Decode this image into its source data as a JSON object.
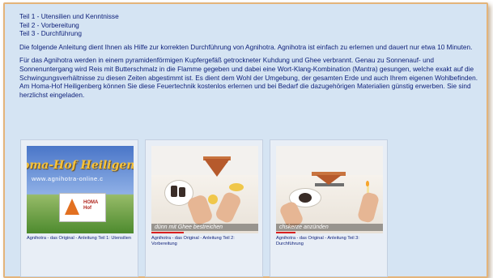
{
  "parts": [
    "Teil 1 - Utensilien und Kenntnisse",
    "Teil 2 - Vorbereitung",
    "Teil 3 - Durchführung"
  ],
  "intro": "Die folgende Anleitung dient Ihnen als Hilfe zur korrekten Durchführung von Agnihotra. Agnihotra ist einfach zu erlernen und dauert nur etwa 10 Minuten.",
  "body": "Für das Agnihotra werden in einem pyramidenförmigen Kupfergefäß getrockneter Kuhdung und Ghee verbrannt. Genau zu Sonnenauf- und Sonnenuntergang wird Reis mit Butterschmalz in die Flamme gegeben und dabei eine Wort-Klang-Kombination (Mantra) gesungen, welche exakt auf die Schwingungsverhältnisse zu diesen Zeiten abgestimmt ist. Es dient dem Wohl der Umgebung, der gesamten Erde und auch Ihrem eigenen Wohlbefinden. Am Homa-Hof Heiligenberg können Sie diese Feuertechnik kostenlos erlernen und bei Bedarf die dazugehörigen Materialien günstig erwerben. Sie sind herzlichst eingeladen.",
  "videos": [
    {
      "thumb_title": "oma-Hof Heiligenbe",
      "thumb_url": "www.agnihotra-online.c",
      "logo_line1": "HOMA",
      "logo_line2": "Hof",
      "caption": "Agnihotra - das Original - Anleitung Teil 1: Utensilien"
    },
    {
      "overlay": "dünn mit Ghee bestreichen",
      "caption": "Agnihotra - das Original - Anleitung Teil 2: Vorbereitung"
    },
    {
      "overlay": "chskerze anzünden",
      "caption": "Agnihotra - das Original - Anleitung Teil 3: Durchführung"
    }
  ],
  "colors": {
    "panel_bg": "#d5e4f3",
    "frame_border": "#e4b47a",
    "text": "#0c1e78"
  }
}
